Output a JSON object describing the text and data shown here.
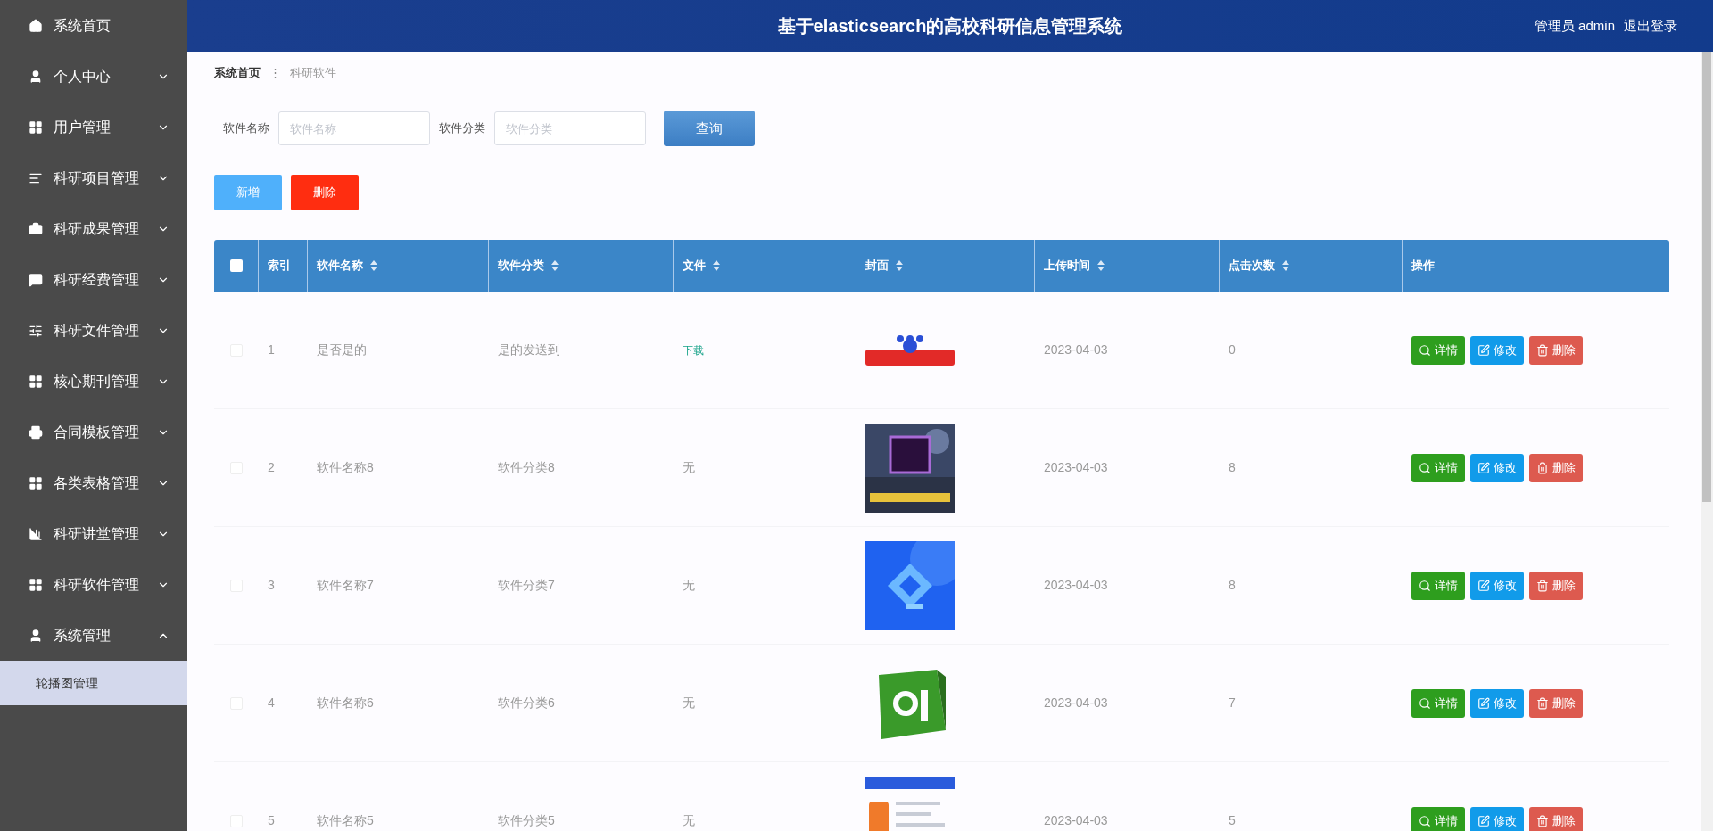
{
  "sidebar": {
    "items": [
      {
        "label": "系统首页",
        "kind": "home"
      },
      {
        "label": "个人中心",
        "kind": "user",
        "expanded": false
      },
      {
        "label": "用户管理",
        "kind": "grid",
        "expanded": false
      },
      {
        "label": "科研项目管理",
        "kind": "list",
        "expanded": false
      },
      {
        "label": "科研成果管理",
        "kind": "briefcase",
        "expanded": false
      },
      {
        "label": "科研经费管理",
        "kind": "chat",
        "expanded": false
      },
      {
        "label": "科研文件管理",
        "kind": "sliders",
        "expanded": false
      },
      {
        "label": "核心期刊管理",
        "kind": "grid",
        "expanded": false
      },
      {
        "label": "合同模板管理",
        "kind": "printer",
        "expanded": false
      },
      {
        "label": "各类表格管理",
        "kind": "grid",
        "expanded": false
      },
      {
        "label": "科研讲堂管理",
        "kind": "chart",
        "expanded": false
      },
      {
        "label": "科研软件管理",
        "kind": "grid",
        "expanded": false
      },
      {
        "label": "系统管理",
        "kind": "user",
        "expanded": true,
        "children": [
          {
            "label": "轮播图管理",
            "selected": true
          }
        ]
      }
    ]
  },
  "header": {
    "title": "基于elasticsearch的高校科研信息管理系统",
    "user": "管理员 admin",
    "logout": "退出登录"
  },
  "breadcrumb": [
    "系统首页",
    "科研软件"
  ],
  "breadcrumb_separator": "⋮",
  "search": {
    "fields": [
      {
        "label": "软件名称",
        "placeholder": "软件名称"
      },
      {
        "label": "软件分类",
        "placeholder": "软件分类"
      }
    ],
    "button": "查询"
  },
  "actions": [
    {
      "label": "新增",
      "kind": "add"
    },
    {
      "label": "删除",
      "kind": "delete"
    }
  ],
  "table": {
    "select_all": {
      "checked": false
    },
    "columns": [
      {
        "label": "索引",
        "sortable": false
      },
      {
        "label": "软件名称",
        "sortable": true
      },
      {
        "label": "软件分类",
        "sortable": true
      },
      {
        "label": "文件",
        "sortable": true
      },
      {
        "label": "封面",
        "sortable": true
      },
      {
        "label": "上传时间",
        "sortable": true
      },
      {
        "label": "点击次数",
        "sortable": true
      },
      {
        "label": "操作",
        "sortable": false
      }
    ],
    "rows": [
      {
        "checked": false,
        "index": "1",
        "name": "是否是的",
        "category": "是的发送到",
        "file": {
          "kind": "link",
          "text": "下载"
        },
        "uploaded": "2023-04-03",
        "clicks": "0",
        "buttons": [
          {
            "label": "详情",
            "kind": "detail"
          },
          {
            "label": "修改",
            "kind": "edit"
          },
          {
            "label": "删除",
            "kind": "delete"
          }
        ]
      },
      {
        "checked": false,
        "index": "2",
        "name": "软件名称8",
        "category": "软件分类8",
        "file": {
          "kind": "text",
          "text": "无"
        },
        "uploaded": "2023-04-03",
        "clicks": "8",
        "buttons": [
          {
            "label": "详情",
            "kind": "detail"
          },
          {
            "label": "修改",
            "kind": "edit"
          },
          {
            "label": "删除",
            "kind": "delete"
          }
        ]
      },
      {
        "checked": false,
        "index": "3",
        "name": "软件名称7",
        "category": "软件分类7",
        "file": {
          "kind": "text",
          "text": "无"
        },
        "uploaded": "2023-04-03",
        "clicks": "8",
        "buttons": [
          {
            "label": "详情",
            "kind": "detail"
          },
          {
            "label": "修改",
            "kind": "edit"
          },
          {
            "label": "删除",
            "kind": "delete"
          }
        ]
      },
      {
        "checked": false,
        "index": "4",
        "name": "软件名称6",
        "category": "软件分类6",
        "file": {
          "kind": "text",
          "text": "无"
        },
        "uploaded": "2023-04-03",
        "clicks": "7",
        "buttons": [
          {
            "label": "详情",
            "kind": "detail"
          },
          {
            "label": "修改",
            "kind": "edit"
          },
          {
            "label": "删除",
            "kind": "delete"
          }
        ]
      },
      {
        "checked": false,
        "index": "5",
        "name": "软件名称5",
        "category": "软件分类5",
        "file": {
          "kind": "text",
          "text": "无"
        },
        "uploaded": "2023-04-03",
        "clicks": "5",
        "buttons": [
          {
            "label": "详情",
            "kind": "detail"
          },
          {
            "label": "修改",
            "kind": "edit"
          },
          {
            "label": "删除",
            "kind": "delete"
          }
        ]
      }
    ]
  }
}
